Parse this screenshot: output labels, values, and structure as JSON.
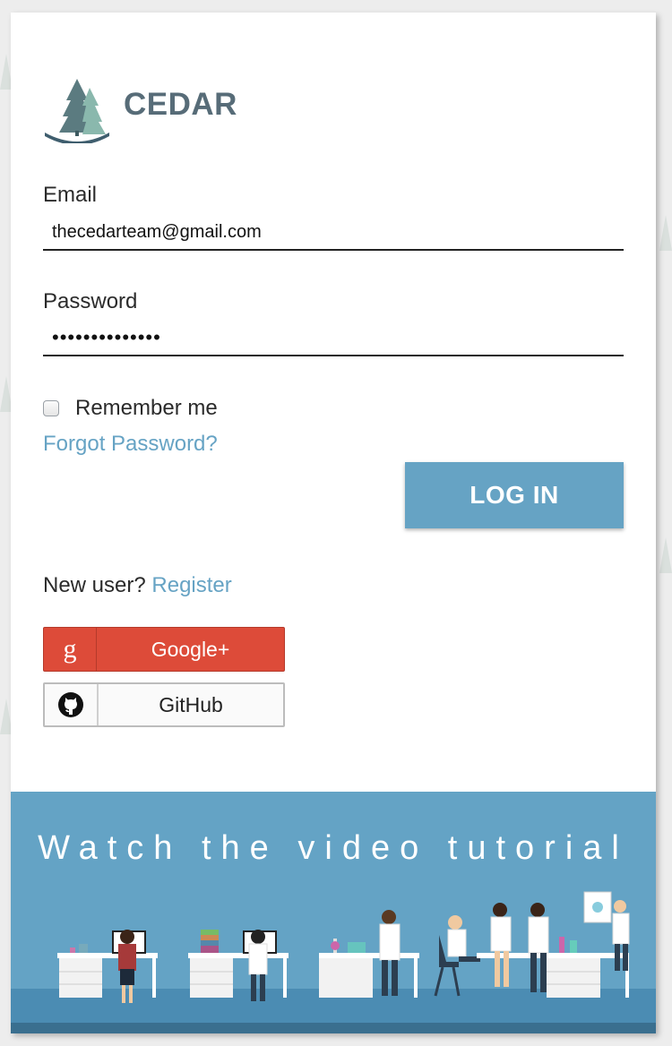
{
  "brand": {
    "name": "CEDAR"
  },
  "form": {
    "email_label": "Email",
    "email_value": "thecedarteam@gmail.com",
    "password_label": "Password",
    "password_value": "••••••••••••••",
    "remember_label": "Remember me",
    "remember_checked": false,
    "forgot_label": "Forgot Password?",
    "login_label": "LOG IN"
  },
  "register": {
    "prompt": "New user?",
    "link_label": "Register"
  },
  "social": {
    "google_label": "Google+",
    "google_icon": "g",
    "github_label": "GitHub"
  },
  "footer": {
    "video_title": "Watch the video tutorial"
  },
  "colors": {
    "accent": "#66a3c4",
    "brand_text": "#576c78",
    "google": "#dd4b39",
    "footer_bg": "#64a3c5"
  }
}
